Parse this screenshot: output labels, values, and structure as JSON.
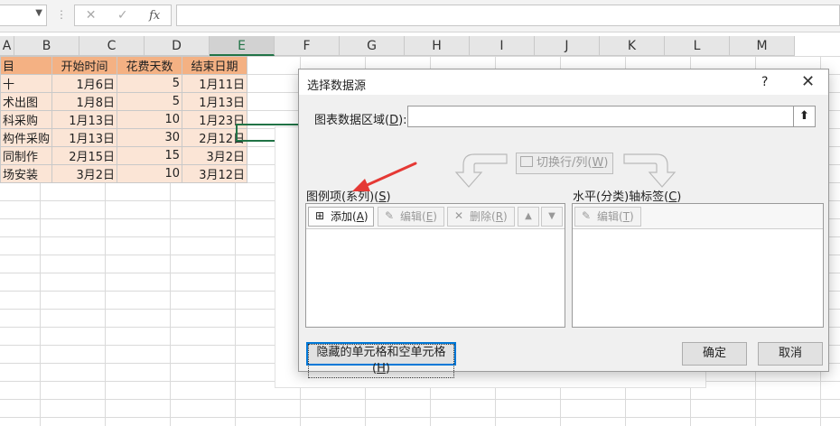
{
  "formula_bar": {
    "name_box_value": "",
    "cancel_icon": "✕",
    "enter_icon": "✓",
    "fx_label": "fx",
    "formula_value": ""
  },
  "columns": [
    "A",
    "B",
    "C",
    "D",
    "E",
    "F",
    "G",
    "H",
    "I",
    "J",
    "K",
    "L",
    "M"
  ],
  "selected_column": "E",
  "sheet": {
    "header": [
      "目",
      "开始时间",
      "花费天数",
      "结束日期"
    ],
    "rows": [
      [
        "十",
        "1月6日",
        "5",
        "1月11日"
      ],
      [
        "术出图",
        "1月8日",
        "5",
        "1月13日"
      ],
      [
        "科采购",
        "1月13日",
        "10",
        "1月23日"
      ],
      [
        "构件采购",
        "1月13日",
        "30",
        "2月12日"
      ],
      [
        "同制作",
        "2月15日",
        "15",
        "3月2日"
      ],
      [
        "场安装",
        "3月2日",
        "10",
        "3月12日"
      ]
    ]
  },
  "dialog": {
    "title": "选择数据源",
    "help": "?",
    "close": "✕",
    "range_label": "图表数据区域(",
    "range_key": "D",
    "range_label_end": "):",
    "range_value": "",
    "range_btn_icon": "⬆",
    "swap_label": "切换行/列(",
    "swap_key": "W",
    "swap_end": ")",
    "legend_label": "图例项(系列)(",
    "legend_key": "S",
    "legend_end": ")",
    "add_label": "添加(",
    "add_key": "A",
    "add_end": ")",
    "edit_label": "编辑(",
    "edit_key": "E",
    "edit_end": ")",
    "delete_label": "删除(",
    "delete_key": "R",
    "delete_end": ")",
    "axis_label": "水平(分类)轴标签(",
    "axis_key": "C",
    "axis_end": ")",
    "axis_edit_label": "编辑(",
    "axis_edit_key": "T",
    "axis_edit_end": ")",
    "hidden_cells_label": "隐藏的单元格和空单元格(",
    "hidden_cells_key": "H",
    "hidden_cells_end": ")",
    "ok_label": "确定",
    "cancel_label": "取消"
  },
  "colors": {
    "header_fill": "#f4b183",
    "row_fill": "#fbe5d6",
    "excel_green": "#217346",
    "annotation_red": "#e53935"
  }
}
